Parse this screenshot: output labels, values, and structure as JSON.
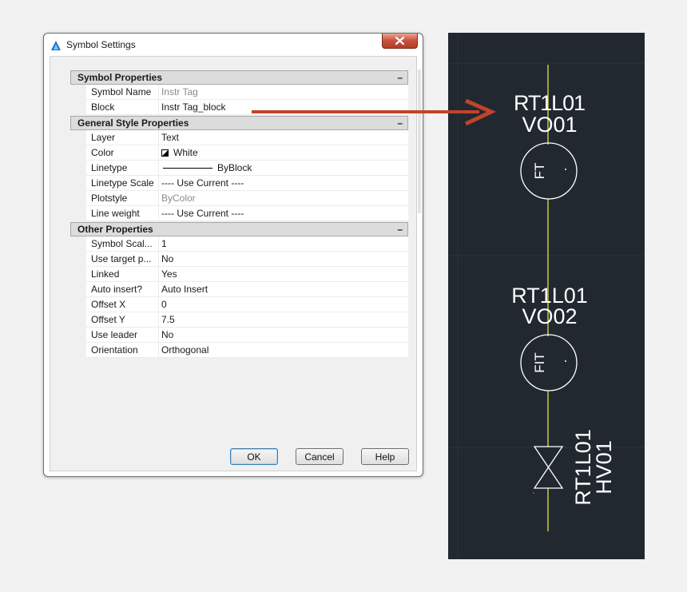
{
  "dialog": {
    "title": "Symbol Settings",
    "close_label": "✕",
    "sections": [
      {
        "title": "Symbol Properties",
        "collapse": "–",
        "rows": [
          {
            "name": "Symbol Name",
            "value": "Instr Tag",
            "dim": true
          },
          {
            "name": "Block",
            "value": "Instr Tag_block"
          }
        ]
      },
      {
        "title": "General Style Properties",
        "collapse": "–",
        "rows": [
          {
            "name": "Layer",
            "value": "Text"
          },
          {
            "name": "Color",
            "value": "White"
          },
          {
            "name": "Linetype",
            "value": "ByBlock"
          },
          {
            "name": "Linetype Scale",
            "value": "---- Use Current ----"
          },
          {
            "name": "Plotstyle",
            "value": "ByColor",
            "dim": true
          },
          {
            "name": "Line weight",
            "value": "---- Use Current ----"
          }
        ]
      },
      {
        "title": "Other Properties",
        "collapse": "–",
        "rows": [
          {
            "name": "Symbol  Scal...",
            "value": "1"
          },
          {
            "name": "Use target p...",
            "value": "No"
          },
          {
            "name": "Linked",
            "value": "Yes"
          },
          {
            "name": "Auto insert?",
            "value": "Auto Insert"
          },
          {
            "name": "Offset X",
            "value": "0"
          },
          {
            "name": "Offset Y",
            "value": "7.5"
          },
          {
            "name": "Use leader",
            "value": "No"
          },
          {
            "name": "Orientation",
            "value": "Orthogonal"
          }
        ]
      }
    ],
    "buttons": {
      "ok": "OK",
      "cancel": "Cancel",
      "help": "Help"
    }
  },
  "drawing": {
    "tag1_line1": "RT1L01",
    "tag1_line2": "VO01",
    "bubble1": "FT",
    "tag2_line1": "RT1L01",
    "tag2_line2": "VO02",
    "bubble2": "FIT",
    "valve_line1": "RT1L01",
    "valve_line2": "HV01"
  },
  "colors": {
    "canvas_bg": "#212830",
    "pipe": "#e6e24a",
    "entity": "#ffffff",
    "arrow": "#c0432c"
  },
  "icons": {
    "app": "autocad-logo-icon",
    "close": "close-icon",
    "color_swatch": "color-swatch-icon"
  }
}
